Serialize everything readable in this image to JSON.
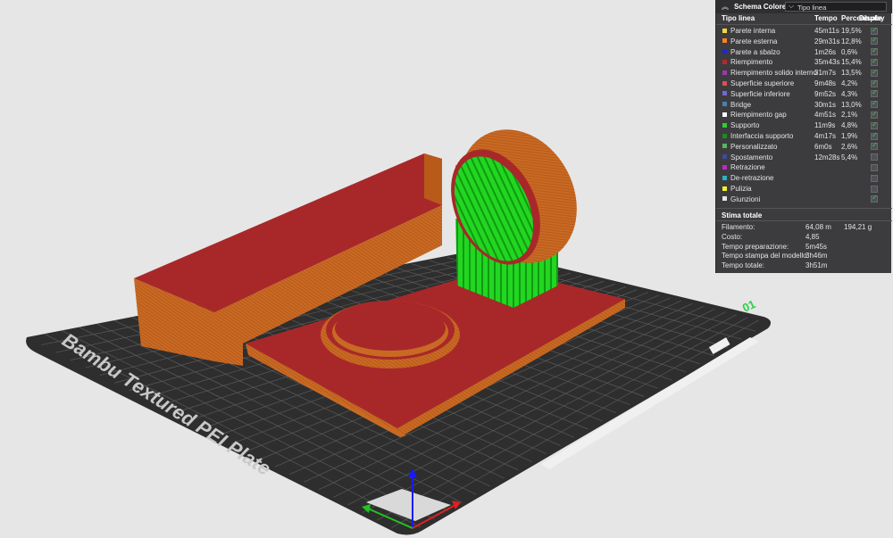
{
  "legend": {
    "title": "Schema Colore",
    "view_mode": "Tipo linea",
    "columns": {
      "name": "Tipo linea",
      "time": "Tempo",
      "percent": "Percentuale",
      "display": "Display"
    },
    "rows": [
      {
        "name": "Parete interna",
        "time": "45m11s",
        "percent": "19,5%",
        "color": "#f5d442",
        "checked": true
      },
      {
        "name": "Parete esterna",
        "time": "29m31s",
        "percent": "12,8%",
        "color": "#ff7f26",
        "checked": true
      },
      {
        "name": "Parete a sbalzo",
        "time": "1m26s",
        "percent": "0,6%",
        "color": "#1f26d9",
        "checked": true
      },
      {
        "name": "Riempimento",
        "time": "35m43s",
        "percent": "15,4%",
        "color": "#b3292e",
        "checked": true
      },
      {
        "name": "Riempimento solido interno",
        "time": "31m7s",
        "percent": "13,5%",
        "color": "#9b3aa8",
        "checked": true
      },
      {
        "name": "Superficie superiore",
        "time": "9m48s",
        "percent": "4,2%",
        "color": "#e34d4d",
        "checked": true
      },
      {
        "name": "Superficie inferiore",
        "time": "9m52s",
        "percent": "4,3%",
        "color": "#6b6bd6",
        "checked": true
      },
      {
        "name": "Bridge",
        "time": "30m1s",
        "percent": "13,0%",
        "color": "#4d7fb3",
        "checked": true
      },
      {
        "name": "Riempimento gap",
        "time": "4m51s",
        "percent": "2,1%",
        "color": "#ffffff",
        "checked": true
      },
      {
        "name": "Supporto",
        "time": "11m9s",
        "percent": "4,8%",
        "color": "#2bd12b",
        "checked": true
      },
      {
        "name": "Interfaccia supporto",
        "time": "4m17s",
        "percent": "1,9%",
        "color": "#1a8c1a",
        "checked": true
      },
      {
        "name": "Personalizzato",
        "time": "6m0s",
        "percent": "2,6%",
        "color": "#5eb35e",
        "checked": true
      },
      {
        "name": "Spostamento",
        "time": "12m28s",
        "percent": "5,4%",
        "color": "#3d4d99",
        "checked": false
      },
      {
        "name": "Retrazione",
        "time": "",
        "percent": "",
        "color": "#c229c2",
        "checked": false
      },
      {
        "name": "De-retrazione",
        "time": "",
        "percent": "",
        "color": "#2bb3c2",
        "checked": false
      },
      {
        "name": "Pulizia",
        "time": "",
        "percent": "",
        "color": "#f2f229",
        "checked": false
      },
      {
        "name": "Giunzioni",
        "time": "",
        "percent": "",
        "color": "#e6e6e6",
        "checked": true
      }
    ],
    "totals": {
      "title": "Stima totale",
      "rows": [
        {
          "label": "Filamento:",
          "value": "64,08 m",
          "value2": "194,21 g"
        },
        {
          "label": "Costo:",
          "value": "4,85",
          "value2": ""
        },
        {
          "label": "Tempo preparazione:",
          "value": "5m45s",
          "value2": ""
        },
        {
          "label": "Tempo stampa del modello:",
          "value": "3h46m",
          "value2": ""
        },
        {
          "label": "Tempo totale:",
          "value": "3h51m",
          "value2": ""
        }
      ]
    }
  },
  "plate": {
    "name": "Bambu Textured PEI Plate",
    "plate_number": "01"
  },
  "colors": {
    "model_orange": "#c96a24",
    "infill_red": "#a8282a",
    "support_green": "#22d622",
    "plate_dark": "#2e2e2e",
    "background": "#e6e6e6"
  }
}
